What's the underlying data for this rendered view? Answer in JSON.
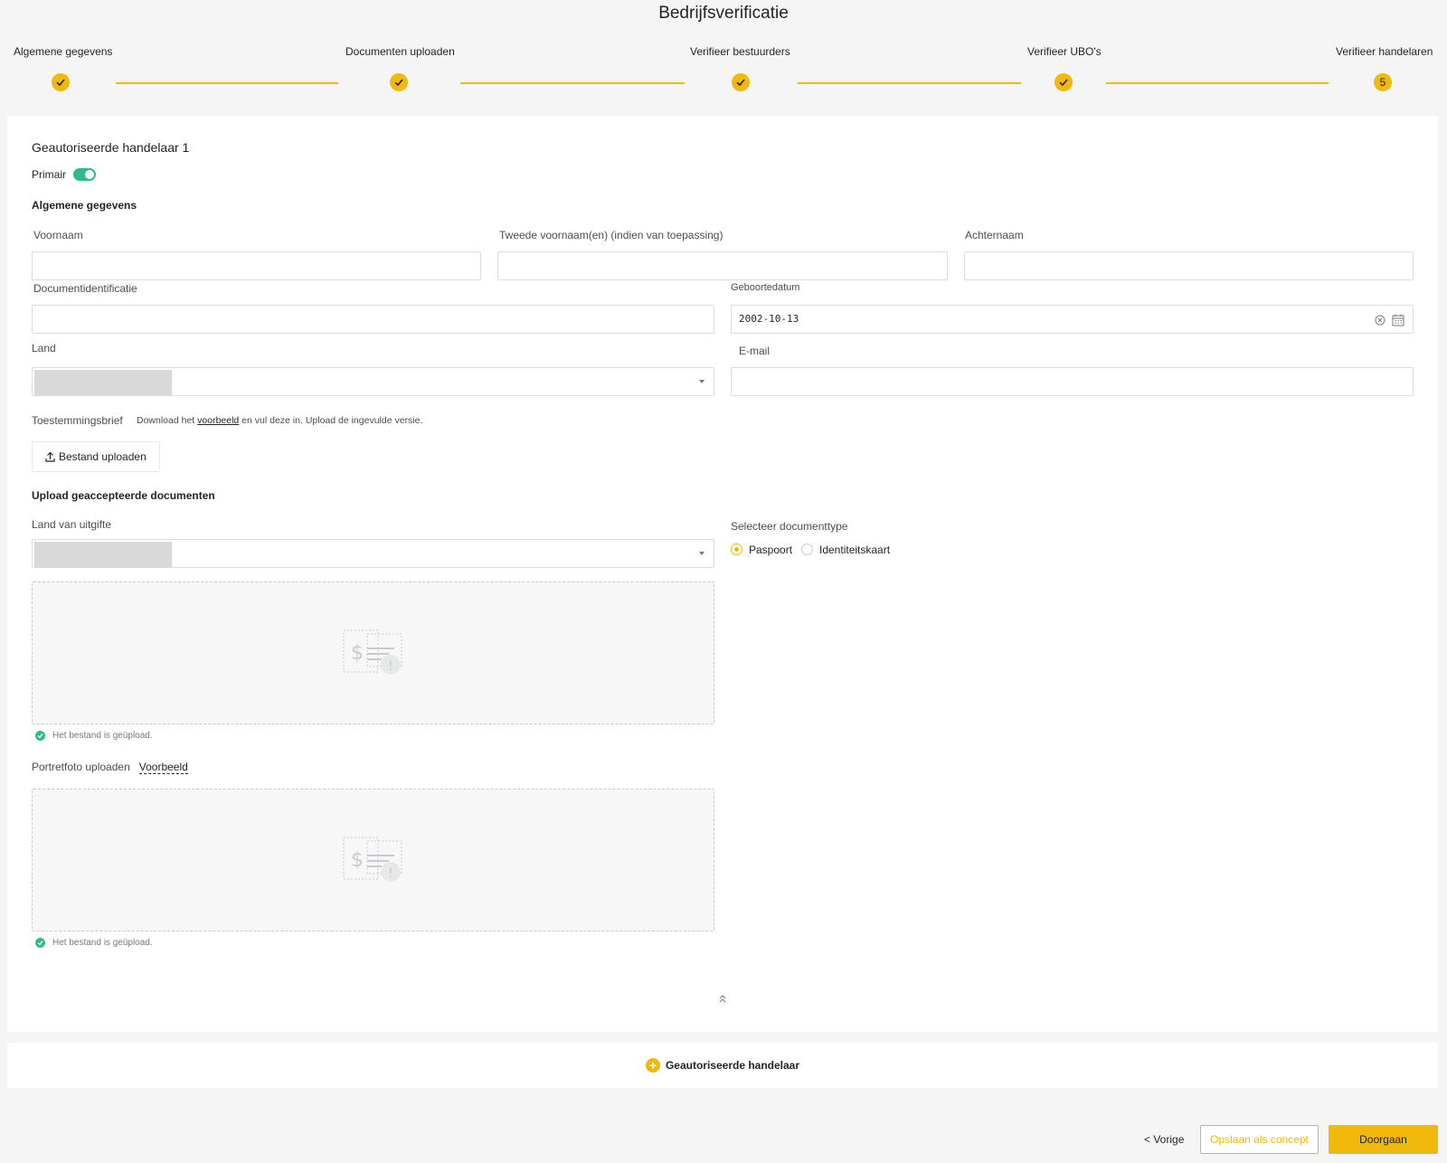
{
  "page": {
    "title": "Bedrijfsverificatie"
  },
  "steps": [
    {
      "label": "Algemene gegevens",
      "status": "done"
    },
    {
      "label": "Documenten uploaden",
      "status": "done"
    },
    {
      "label": "Verifieer bestuurders",
      "status": "done"
    },
    {
      "label": "Verifieer UBO's",
      "status": "done"
    },
    {
      "label": "Verifieer handelaren",
      "status": "current",
      "number": "5"
    }
  ],
  "trader": {
    "heading": "Geautoriseerde handelaar 1",
    "primary_label": "Primair",
    "primary_on": true,
    "section_general": "Algemene gegevens",
    "fields": {
      "first_name": {
        "label": "Voornaam",
        "value": ""
      },
      "middle_name": {
        "label": "Tweede voornaam(en) (indien van toepassing)",
        "value": ""
      },
      "last_name": {
        "label": "Achternaam",
        "value": ""
      },
      "doc_id": {
        "label": "Documentidentificatie",
        "value": ""
      },
      "birthdate": {
        "label": "Geboortedatum",
        "value": "2002-10-13"
      },
      "country": {
        "label": "Land",
        "value": ""
      },
      "email": {
        "label": "E-mail",
        "value": ""
      }
    },
    "consent": {
      "label": "Toestemmingsbrief",
      "text_before": "Download het",
      "link": "voorbeeld",
      "text_after": "en vul deze in. Upload de ingevulde versie.",
      "upload_button": "Bestand uploaden"
    },
    "docs": {
      "heading": "Upload geaccepteerde documenten",
      "issue_country_label": "Land van uitgifte",
      "doctype_label": "Selecteer documenttype",
      "doctype_options": [
        "Paspoort",
        "Identiteitskaart"
      ],
      "doctype_selected": "Paspoort",
      "uploaded_msg": "Het bestand is geüpload.",
      "portrait_label": "Portretfoto uploaden",
      "portrait_example": "Voorbeeld",
      "portrait_uploaded_msg": "Het bestand is geüpload."
    }
  },
  "add_trader_label": "Geautoriseerde handelaar",
  "footer": {
    "prev": "< Vorige",
    "save_draft": "Opslaan als concept",
    "next": "Doorgaan"
  },
  "colors": {
    "accent": "#f0b90b",
    "success": "#2ebd85"
  }
}
